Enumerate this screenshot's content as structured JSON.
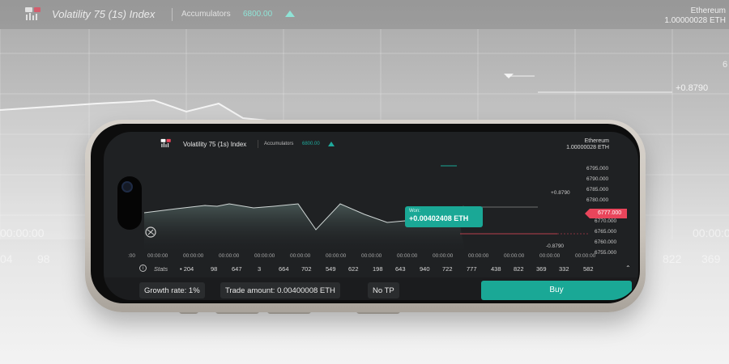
{
  "app": {
    "title": "Volatility 75 (1s) Index",
    "contract_type": "Accumulators",
    "spot_price": "6800.00",
    "account": {
      "currency": "Ethereum",
      "balance": "1.00000028 ETH"
    }
  },
  "background": {
    "profit_label": "+0.8790",
    "axis_fragment": "6",
    "time_labels": [
      "00:00:00",
      "00:00:00"
    ],
    "stats_fragments": [
      "04",
      "98",
      "822",
      "369"
    ]
  },
  "chart": {
    "profit_label": "+0.8790",
    "loss_label": "-0.8790",
    "price_axis": [
      "6795.000",
      "6790.000",
      "6785.000",
      "6780.000",
      "6770.000",
      "6765.000",
      "6760.000",
      "6755.000"
    ],
    "current_price": "6777.000",
    "won": {
      "label": "Won:",
      "value": "+0.00402408 ETH"
    },
    "time_labels": [
      ":00",
      "00:00:00",
      "00:00:00",
      "00:00:00",
      "00:00:00",
      "00:00:00",
      "00:00:00",
      "00:00:00",
      "00:00:00",
      "00:00:00",
      "00:00:00",
      "00:00:00",
      "00:00:00",
      "00:00:00"
    ]
  },
  "stats": {
    "label": "Stats",
    "values": [
      "• 204",
      "98",
      "647",
      "3",
      "664",
      "702",
      "549",
      "622",
      "198",
      "643",
      "940",
      "722",
      "777",
      "438",
      "822",
      "369",
      "332",
      "582"
    ]
  },
  "trade_bar": {
    "growth_rate": "Growth rate: 1%",
    "trade_amount": "Trade amount: 0.00400008 ETH",
    "take_profit": "No TP",
    "buy_label": "Buy"
  },
  "colors": {
    "accent": "#1aa896",
    "loss": "#e9455b",
    "screen_bg": "#1f2123"
  },
  "icons": [
    "app-logo-icon",
    "arrow-up-icon",
    "info-icon",
    "chevron-up-icon",
    "rotate-icon"
  ]
}
